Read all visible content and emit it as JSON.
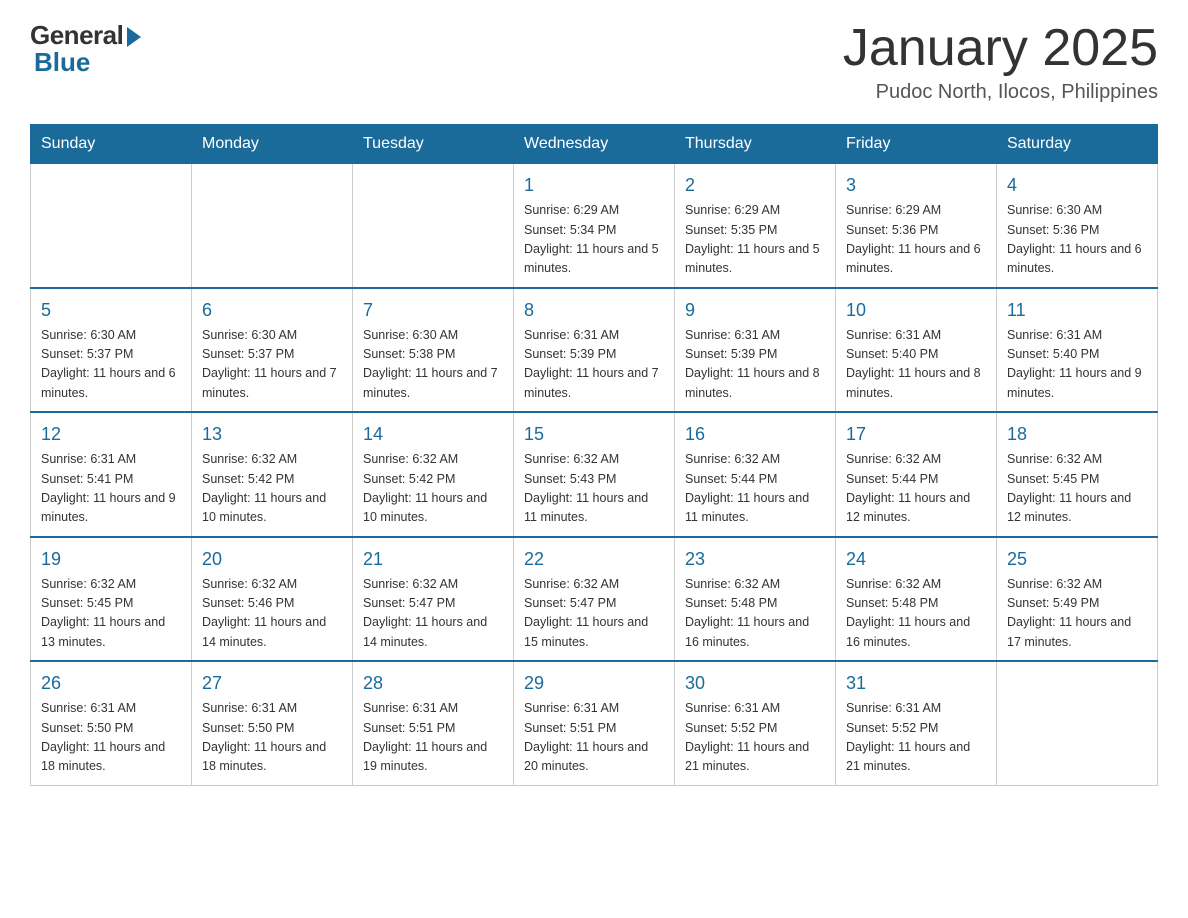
{
  "logo": {
    "general": "General",
    "blue": "Blue"
  },
  "title": {
    "month_year": "January 2025",
    "location": "Pudoc North, Ilocos, Philippines"
  },
  "days_of_week": [
    "Sunday",
    "Monday",
    "Tuesday",
    "Wednesday",
    "Thursday",
    "Friday",
    "Saturday"
  ],
  "weeks": [
    [
      {
        "day": "",
        "info": ""
      },
      {
        "day": "",
        "info": ""
      },
      {
        "day": "",
        "info": ""
      },
      {
        "day": "1",
        "info": "Sunrise: 6:29 AM\nSunset: 5:34 PM\nDaylight: 11 hours and 5 minutes."
      },
      {
        "day": "2",
        "info": "Sunrise: 6:29 AM\nSunset: 5:35 PM\nDaylight: 11 hours and 5 minutes."
      },
      {
        "day": "3",
        "info": "Sunrise: 6:29 AM\nSunset: 5:36 PM\nDaylight: 11 hours and 6 minutes."
      },
      {
        "day": "4",
        "info": "Sunrise: 6:30 AM\nSunset: 5:36 PM\nDaylight: 11 hours and 6 minutes."
      }
    ],
    [
      {
        "day": "5",
        "info": "Sunrise: 6:30 AM\nSunset: 5:37 PM\nDaylight: 11 hours and 6 minutes."
      },
      {
        "day": "6",
        "info": "Sunrise: 6:30 AM\nSunset: 5:37 PM\nDaylight: 11 hours and 7 minutes."
      },
      {
        "day": "7",
        "info": "Sunrise: 6:30 AM\nSunset: 5:38 PM\nDaylight: 11 hours and 7 minutes."
      },
      {
        "day": "8",
        "info": "Sunrise: 6:31 AM\nSunset: 5:39 PM\nDaylight: 11 hours and 7 minutes."
      },
      {
        "day": "9",
        "info": "Sunrise: 6:31 AM\nSunset: 5:39 PM\nDaylight: 11 hours and 8 minutes."
      },
      {
        "day": "10",
        "info": "Sunrise: 6:31 AM\nSunset: 5:40 PM\nDaylight: 11 hours and 8 minutes."
      },
      {
        "day": "11",
        "info": "Sunrise: 6:31 AM\nSunset: 5:40 PM\nDaylight: 11 hours and 9 minutes."
      }
    ],
    [
      {
        "day": "12",
        "info": "Sunrise: 6:31 AM\nSunset: 5:41 PM\nDaylight: 11 hours and 9 minutes."
      },
      {
        "day": "13",
        "info": "Sunrise: 6:32 AM\nSunset: 5:42 PM\nDaylight: 11 hours and 10 minutes."
      },
      {
        "day": "14",
        "info": "Sunrise: 6:32 AM\nSunset: 5:42 PM\nDaylight: 11 hours and 10 minutes."
      },
      {
        "day": "15",
        "info": "Sunrise: 6:32 AM\nSunset: 5:43 PM\nDaylight: 11 hours and 11 minutes."
      },
      {
        "day": "16",
        "info": "Sunrise: 6:32 AM\nSunset: 5:44 PM\nDaylight: 11 hours and 11 minutes."
      },
      {
        "day": "17",
        "info": "Sunrise: 6:32 AM\nSunset: 5:44 PM\nDaylight: 11 hours and 12 minutes."
      },
      {
        "day": "18",
        "info": "Sunrise: 6:32 AM\nSunset: 5:45 PM\nDaylight: 11 hours and 12 minutes."
      }
    ],
    [
      {
        "day": "19",
        "info": "Sunrise: 6:32 AM\nSunset: 5:45 PM\nDaylight: 11 hours and 13 minutes."
      },
      {
        "day": "20",
        "info": "Sunrise: 6:32 AM\nSunset: 5:46 PM\nDaylight: 11 hours and 14 minutes."
      },
      {
        "day": "21",
        "info": "Sunrise: 6:32 AM\nSunset: 5:47 PM\nDaylight: 11 hours and 14 minutes."
      },
      {
        "day": "22",
        "info": "Sunrise: 6:32 AM\nSunset: 5:47 PM\nDaylight: 11 hours and 15 minutes."
      },
      {
        "day": "23",
        "info": "Sunrise: 6:32 AM\nSunset: 5:48 PM\nDaylight: 11 hours and 16 minutes."
      },
      {
        "day": "24",
        "info": "Sunrise: 6:32 AM\nSunset: 5:48 PM\nDaylight: 11 hours and 16 minutes."
      },
      {
        "day": "25",
        "info": "Sunrise: 6:32 AM\nSunset: 5:49 PM\nDaylight: 11 hours and 17 minutes."
      }
    ],
    [
      {
        "day": "26",
        "info": "Sunrise: 6:31 AM\nSunset: 5:50 PM\nDaylight: 11 hours and 18 minutes."
      },
      {
        "day": "27",
        "info": "Sunrise: 6:31 AM\nSunset: 5:50 PM\nDaylight: 11 hours and 18 minutes."
      },
      {
        "day": "28",
        "info": "Sunrise: 6:31 AM\nSunset: 5:51 PM\nDaylight: 11 hours and 19 minutes."
      },
      {
        "day": "29",
        "info": "Sunrise: 6:31 AM\nSunset: 5:51 PM\nDaylight: 11 hours and 20 minutes."
      },
      {
        "day": "30",
        "info": "Sunrise: 6:31 AM\nSunset: 5:52 PM\nDaylight: 11 hours and 21 minutes."
      },
      {
        "day": "31",
        "info": "Sunrise: 6:31 AM\nSunset: 5:52 PM\nDaylight: 11 hours and 21 minutes."
      },
      {
        "day": "",
        "info": ""
      }
    ]
  ]
}
